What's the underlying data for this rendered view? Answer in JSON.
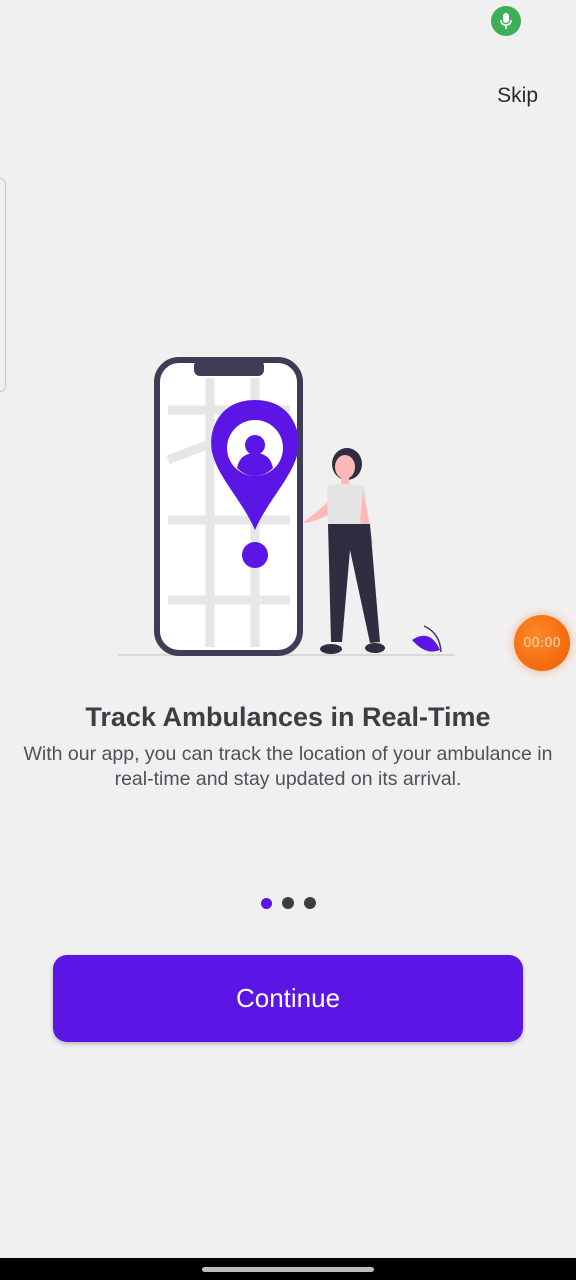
{
  "status": {
    "mic_icon": "microphone-icon"
  },
  "header": {
    "skip_label": "Skip"
  },
  "illustration": {
    "icon": "phone-location-pin-illustration",
    "accent": "#5b16e6"
  },
  "recorder": {
    "time": "00:00"
  },
  "onboarding": {
    "title": "Track Ambulances in Real-Time",
    "description": "With our app, you can track the location of your ambulance in real-time and stay updated on its arrival.",
    "page_count": 3,
    "active_page": 1
  },
  "actions": {
    "continue_label": "Continue"
  },
  "colors": {
    "primary": "#5b16e6",
    "background": "#f1f0f1",
    "text": "#3d3d44"
  }
}
